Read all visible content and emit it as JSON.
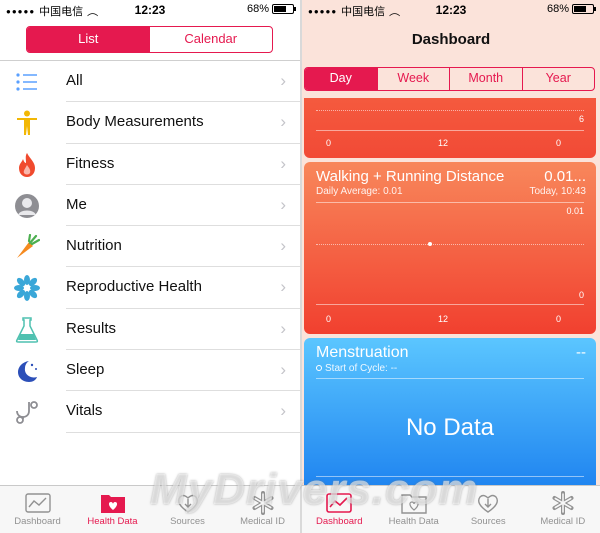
{
  "status": {
    "carrier": "中国电信",
    "time": "12:23",
    "battery": "68%",
    "battery_level": 0.68
  },
  "health_data": {
    "segment": {
      "list_label": "List",
      "calendar_label": "Calendar",
      "selected": "List"
    },
    "categories": [
      {
        "label": "All",
        "icon": "list-icon",
        "color": "#5aa0ff"
      },
      {
        "label": "Body Measurements",
        "icon": "person-figure-icon",
        "color": "#f2b705"
      },
      {
        "label": "Fitness",
        "icon": "flame-icon",
        "color": "#f04a2e"
      },
      {
        "label": "Me",
        "icon": "user-silhouette-icon",
        "color": "#8e8e93"
      },
      {
        "label": "Nutrition",
        "icon": "carrot-icon",
        "color": "#f58a1f"
      },
      {
        "label": "Reproductive Health",
        "icon": "snowflake-flower-icon",
        "color": "#3aa7d8"
      },
      {
        "label": "Results",
        "icon": "flask-icon",
        "color": "#4fc1b0"
      },
      {
        "label": "Sleep",
        "icon": "moon-stars-icon",
        "color": "#2c4fb8"
      },
      {
        "label": "Vitals",
        "icon": "stethoscope-icon",
        "color": "#8e8e93"
      }
    ]
  },
  "tabbar": {
    "tabs": [
      {
        "label": "Dashboard",
        "icon": "chart-icon"
      },
      {
        "label": "Health Data",
        "icon": "folder-heart-icon"
      },
      {
        "label": "Sources",
        "icon": "download-heart-icon"
      },
      {
        "label": "Medical ID",
        "icon": "asterisk-icon"
      }
    ],
    "left_active": "Health Data",
    "right_active": "Dashboard",
    "accent": "#e5194f"
  },
  "dashboard": {
    "title": "Dashboard",
    "periods": [
      "Day",
      "Week",
      "Month",
      "Year"
    ],
    "selected_period": "Day",
    "top_card": {
      "y_max_label": "6",
      "x_labels": [
        "0",
        "12",
        "0"
      ]
    },
    "walking": {
      "title": "Walking + Running Distance",
      "value": "0.01...",
      "daily_average": "Daily Average: 0.01",
      "timestamp": "Today, 10:43",
      "y_top": "0.01",
      "y_bottom": "0",
      "x_labels": [
        "0",
        "12",
        "0"
      ]
    },
    "menstruation": {
      "title": "Menstruation",
      "value": "--",
      "start_of_cycle": "Start of Cycle: --",
      "no_data": "No Data"
    }
  },
  "watermark": "MyDrivers.com"
}
